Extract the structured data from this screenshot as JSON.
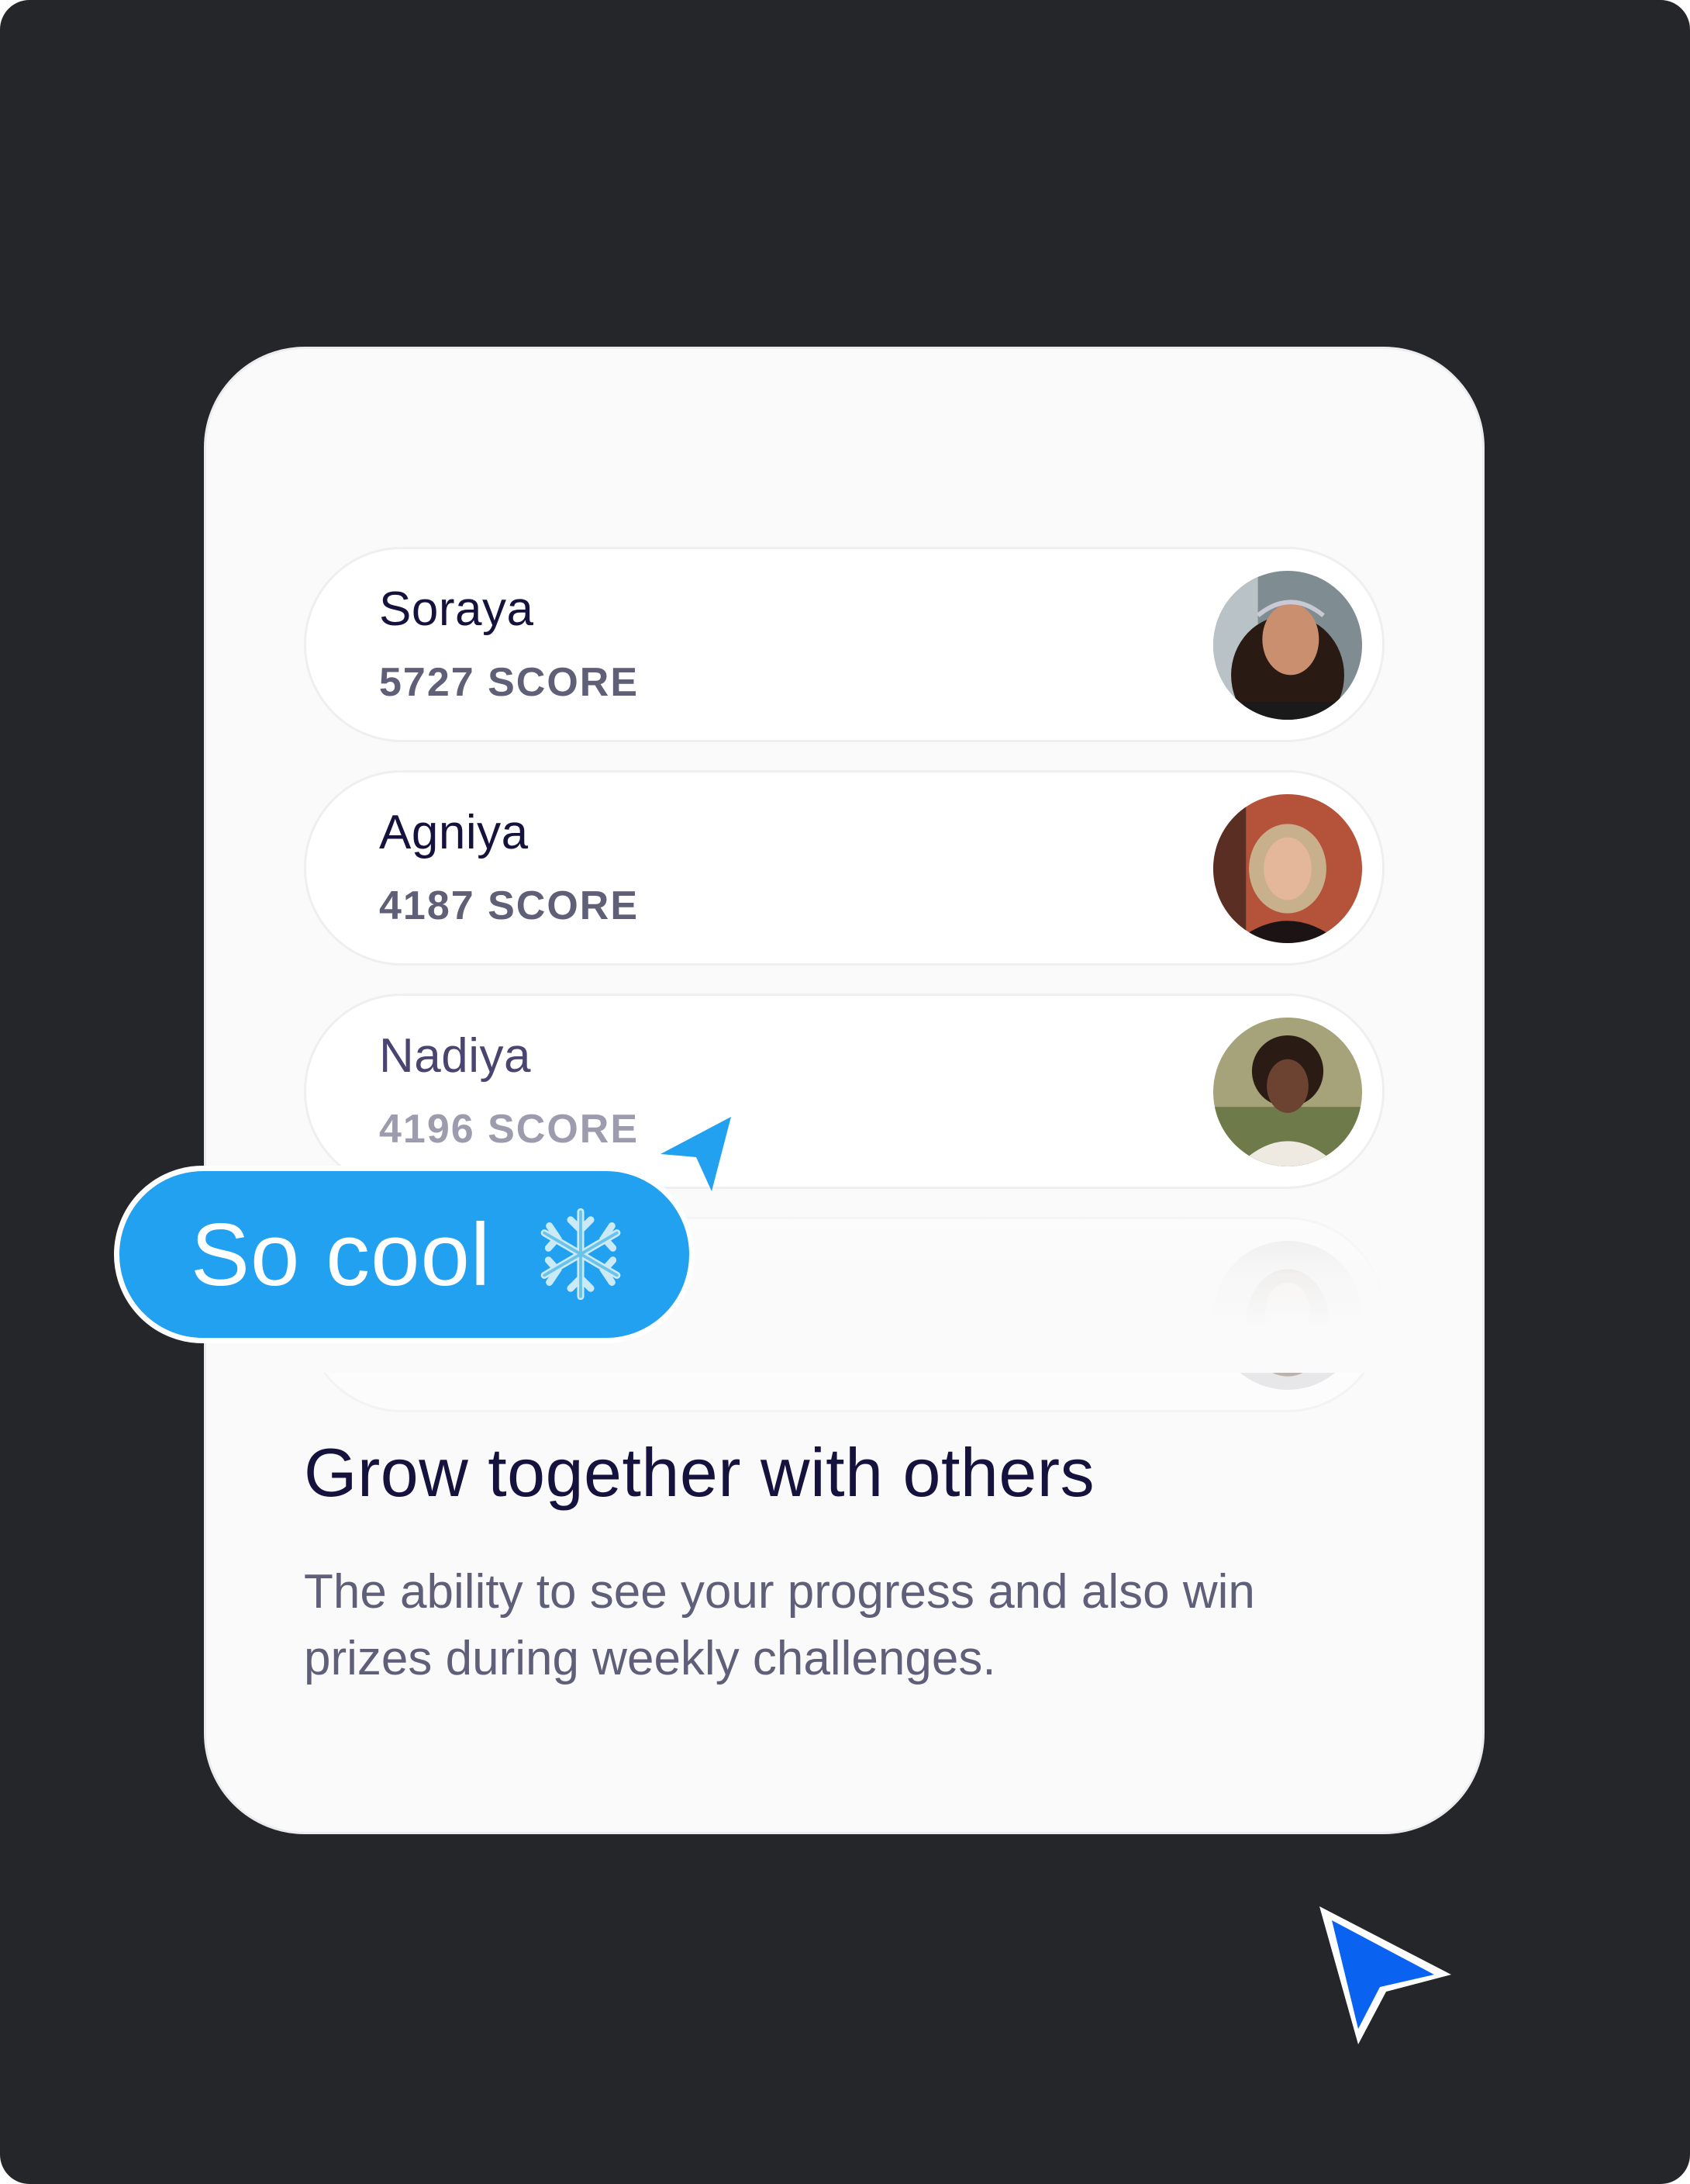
{
  "leaderboard": {
    "rows": [
      {
        "name": "Soraya",
        "score": "5727 SCORE",
        "avatar_icon": "avatar-photo-soraya"
      },
      {
        "name": "Agniya",
        "score": "4187 SCORE",
        "avatar_icon": "avatar-photo-agniya"
      },
      {
        "name": "Nadiya",
        "score": "4196 SCORE",
        "avatar_icon": "avatar-photo-nadiya"
      },
      {
        "name": "",
        "score": "",
        "avatar_icon": "avatar-photo-faded"
      }
    ]
  },
  "feature": {
    "title": "Grow together with others",
    "description": "The ability to see your progress and also win prizes during weekly challenges."
  },
  "chat_bubble": {
    "text": "So cool",
    "emoji_icon": "snowflake-icon",
    "color": "#22a1f0"
  },
  "cursors": [
    {
      "icon": "pointer-cursor-icon",
      "color": "#22a1f0"
    },
    {
      "icon": "pointer-cursor-icon",
      "color": "#0a63f0"
    }
  ],
  "colors": {
    "background": "#252629",
    "card": "#fafafa",
    "heading": "#15123d",
    "muted": "#5f5f78"
  }
}
